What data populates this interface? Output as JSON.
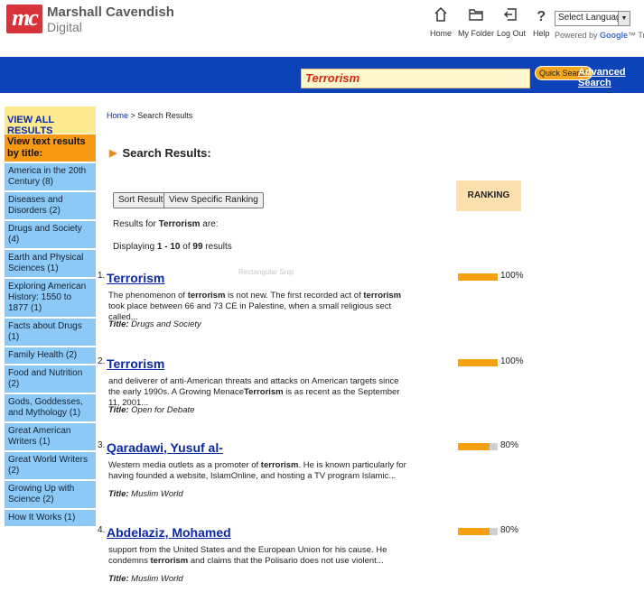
{
  "brand": {
    "logo_mark": "mc",
    "name_line1": "Marshall Cavendish",
    "name_line2": "Digital"
  },
  "toolbar": [
    {
      "label": "Home",
      "icon": "home-icon"
    },
    {
      "label": "My Folder",
      "icon": "folder-icon"
    },
    {
      "label": "Log Out",
      "icon": "logout-icon"
    },
    {
      "label": "Help",
      "icon": "help-icon"
    }
  ],
  "language": {
    "select_value": "Select Language",
    "powered_prefix": "Powered by",
    "powered_brand": "Google",
    "powered_suffix": "™ Translate"
  },
  "search": {
    "query": "Terrorism",
    "quick_label": "Quick Search",
    "advanced_label": "Advanced Search"
  },
  "sidebar": {
    "view_all": "VIEW ALL RESULTS",
    "heading": "View text results by title:",
    "items": [
      "America in the 20th Century (8)",
      "Diseases and Disorders (2)",
      "Drugs and Society (4)",
      "Earth and Physical Sciences (1)",
      "Exploring American History: 1550 to 1877 (1)",
      "Facts about Drugs (1)",
      "Family Health (2)",
      "Food and Nutrition (2)",
      "Gods, Goddesses, and Mythology (1)",
      "Great American Writers (1)",
      "Great World Writers (2)",
      "Growing Up with Science (2)",
      "How It Works (1)"
    ]
  },
  "breadcrumb": {
    "home": "Home",
    "separator": " > ",
    "current": "Search Results"
  },
  "page_title": "Search Results:",
  "buttons": {
    "sort": "Sort Results",
    "ranking": "View Specific Ranking"
  },
  "ranking_header": "RANKING",
  "results_for": {
    "prefix": "Results for ",
    "term": "Terrorism",
    "suffix": " are:"
  },
  "displaying": {
    "prefix": "Displaying ",
    "range": "1 - 10",
    "mid": " of ",
    "total": "99",
    "suffix": " results"
  },
  "ghost_tooltip": "Rectangular Snip",
  "results": [
    {
      "num": "1.",
      "title": "Terrorism",
      "snippet_html": "The phenomenon of <b>terrorism</b> is not new. The first recorded act of <b>terrorism</b> took place between 66 and 73 CE in Palestine, when a small religious sect called...",
      "source_label": "Title:",
      "source": "Drugs and Society",
      "rank": 1.0,
      "pct": "100%"
    },
    {
      "num": "2.",
      "title": "Terrorism",
      "snippet_html": "and deliverer of anti-American threats and attacks on American targets since the early 1990s. A Growing Menace<b>Terrorism</b> is as recent as the September 11, 2001...",
      "source_label": "Title:",
      "source": "Open for Debate",
      "rank": 1.0,
      "pct": "100%"
    },
    {
      "num": "3.",
      "title": "Qaradawi, Yusuf al-",
      "snippet_html": "Western media outlets as a promoter of <b>terrorism</b>. He is known particularly for having founded a website, IslamOnline, and hosting a TV program Islamic...",
      "source_label": "Title:",
      "source": "Muslim World",
      "rank": 0.8,
      "pct": "80%"
    },
    {
      "num": "4.",
      "title": "Abdelaziz, Mohamed",
      "snippet_html": "support from the United States and the European Union for his cause. He condemns <b>terrorism</b> and claims that the Polisario does not use violent...",
      "source_label": "Title:",
      "source": "Muslim World",
      "rank": 0.8,
      "pct": "80%"
    }
  ]
}
